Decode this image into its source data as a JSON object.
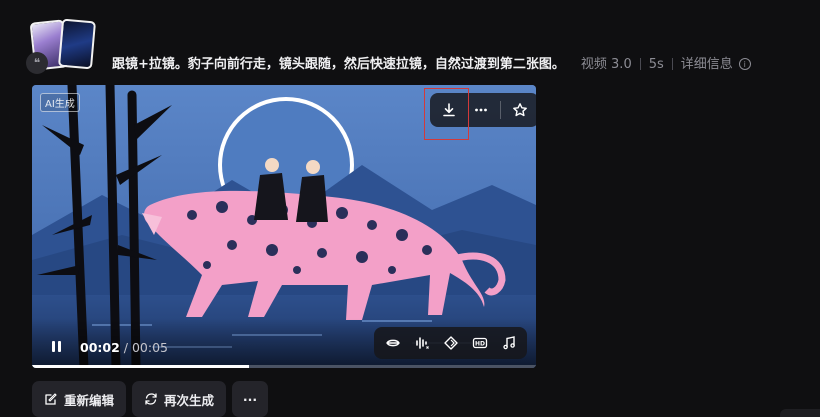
{
  "prompt": {
    "text": "跟镜+拉镜。豹子向前行走，镜头跟随，然后快速拉镜，自然过渡到第二张图。",
    "model": "视频 3.0",
    "duration": "5s",
    "details_label": "详细信息"
  },
  "video": {
    "ai_tag": "AI生成",
    "current_time": "00:02",
    "time_separator": " / ",
    "total_time": "00:05",
    "progress": 0.43
  },
  "toolbar_top": {
    "icons": [
      "download-icon",
      "more-icon",
      "star-icon"
    ]
  },
  "toolbar_bottom": {
    "icons": [
      "lip-sync-icon",
      "audio-wave-icon",
      "diamond-icon",
      "hd-icon",
      "music-note-icon"
    ],
    "hd_text": "HD"
  },
  "actions": {
    "reedit_label": "重新编辑",
    "regenerate_label": "再次生成",
    "more_label": "···"
  },
  "colors": {
    "background": "#0f0f11",
    "sky": "#4a72b6",
    "leopard": "#f3a0c8",
    "highlight": "#d33a3a"
  }
}
